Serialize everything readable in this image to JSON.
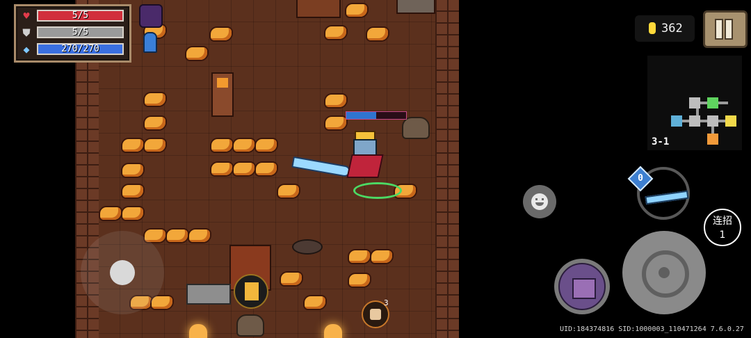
{
  "hud": {
    "health": {
      "label": "5/5",
      "current": 5,
      "max": 5,
      "color": "#d12f3c",
      "icon": "heart-icon"
    },
    "armor": {
      "label": "5/5",
      "current": 5,
      "max": 5,
      "color": "#9a9a9a",
      "icon": "shield-icon"
    },
    "energy": {
      "label": "270/270",
      "current": 270,
      "max": 270,
      "color": "#3a6fe0",
      "icon": "energy-gem-icon"
    }
  },
  "coins": {
    "value": "362",
    "color": "#ffd93a"
  },
  "minimap": {
    "level": "3-1"
  },
  "combo": {
    "label": "连招",
    "count": "1"
  },
  "buffs": {
    "fist_count": "3"
  },
  "footer": {
    "uid": "UID:184374816 SID:1000003_110471264 7.6.0.27"
  }
}
